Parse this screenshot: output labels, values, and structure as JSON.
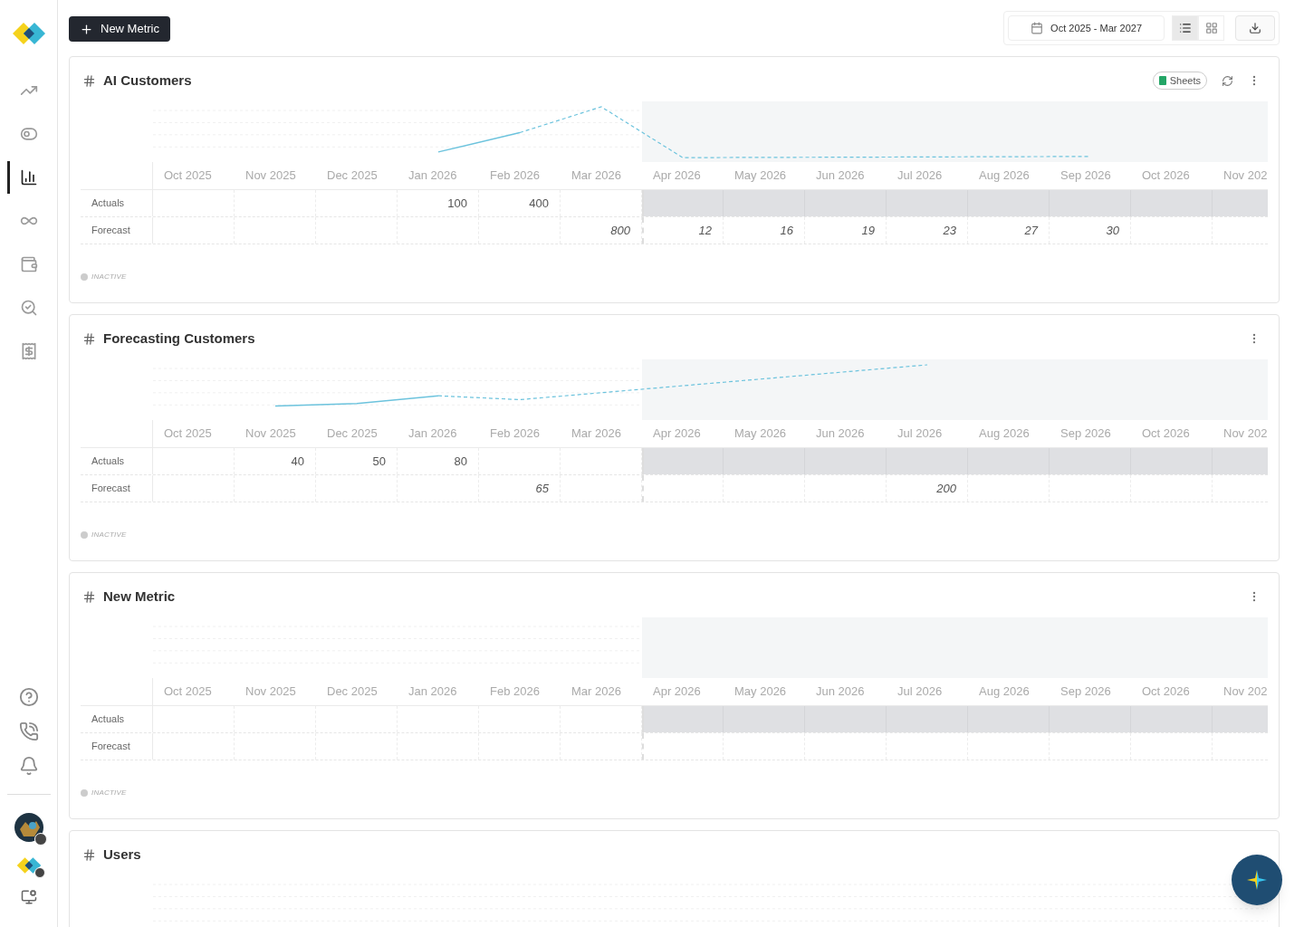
{
  "sidebar": {
    "items": [
      {
        "kind": "trend",
        "selected": false
      },
      {
        "kind": "toggles",
        "selected": false
      },
      {
        "kind": "bars",
        "selected": true
      },
      {
        "kind": "loop",
        "selected": false
      },
      {
        "kind": "wallet",
        "selected": false
      },
      {
        "kind": "explore",
        "selected": false
      },
      {
        "kind": "invoice",
        "selected": false
      }
    ],
    "bottom": [
      {
        "kind": "help"
      },
      {
        "kind": "phone"
      },
      {
        "kind": "bell"
      }
    ]
  },
  "toolbar": {
    "new_button": "New Metric",
    "date_range": "Oct 2025 - Mar 2027",
    "views": [
      {
        "kind": "list",
        "selected": true
      },
      {
        "kind": "grid",
        "selected": false
      }
    ]
  },
  "metrics": [
    {
      "title": "AI Customers",
      "source": "Sheets",
      "rows": [
        {
          "kind": "actual",
          "label": "Actuals"
        },
        {
          "kind": "forecast",
          "label": "Forecast"
        }
      ],
      "columns": [
        {
          "month": "Oct 2025",
          "projected": false
        },
        {
          "month": "Nov 2025",
          "projected": false
        },
        {
          "month": "Dec 2025",
          "projected": false
        },
        {
          "month": "Jan 2026",
          "projected": false,
          "actual": "100"
        },
        {
          "month": "Feb 2026",
          "projected": false,
          "actual": "400"
        },
        {
          "month": "Mar 2026",
          "projected": false,
          "forecast": "800"
        },
        {
          "month": "Apr 2026",
          "projected": true,
          "forecast": "12"
        },
        {
          "month": "May 2026",
          "projected": true,
          "forecast": "16"
        },
        {
          "month": "Jun 2026",
          "projected": true,
          "forecast": "19"
        },
        {
          "month": "Jul 2026",
          "projected": true,
          "forecast": "23"
        },
        {
          "month": "Aug 2026",
          "projected": true,
          "forecast": "27"
        },
        {
          "month": "Sep 2026",
          "projected": true,
          "forecast": "30"
        },
        {
          "month": "Oct 2026",
          "projected": true
        },
        {
          "month": "Nov 202",
          "projected": true
        }
      ],
      "status": {
        "label": "INACTIVE",
        "active": false
      }
    },
    {
      "title": "Forecasting Customers",
      "rows": [
        {
          "kind": "actual",
          "label": "Actuals"
        },
        {
          "kind": "forecast",
          "label": "Forecast"
        }
      ],
      "columns": [
        {
          "month": "Oct 2025",
          "projected": false
        },
        {
          "month": "Nov 2025",
          "projected": false,
          "actual": "40"
        },
        {
          "month": "Dec 2025",
          "projected": false,
          "actual": "50"
        },
        {
          "month": "Jan 2026",
          "projected": false,
          "actual": "80"
        },
        {
          "month": "Feb 2026",
          "projected": false,
          "forecast": "65"
        },
        {
          "month": "Mar 2026",
          "projected": false
        },
        {
          "month": "Apr 2026",
          "projected": true
        },
        {
          "month": "May 2026",
          "projected": true
        },
        {
          "month": "Jun 2026",
          "projected": true
        },
        {
          "month": "Jul 2026",
          "projected": true,
          "forecast": "200"
        },
        {
          "month": "Aug 2026",
          "projected": true
        },
        {
          "month": "Sep 2026",
          "projected": true
        },
        {
          "month": "Oct 2026",
          "projected": true
        },
        {
          "month": "Nov 202",
          "projected": true
        }
      ],
      "status": {
        "label": "INACTIVE",
        "active": false
      }
    },
    {
      "title": "New Metric",
      "rows": [
        {
          "kind": "actual",
          "label": "Actuals"
        },
        {
          "kind": "forecast",
          "label": "Forecast"
        }
      ],
      "columns": [
        {
          "month": "Oct 2025",
          "projected": false
        },
        {
          "month": "Nov 2025",
          "projected": false
        },
        {
          "month": "Dec 2025",
          "projected": false
        },
        {
          "month": "Jan 2026",
          "projected": false
        },
        {
          "month": "Feb 2026",
          "projected": false
        },
        {
          "month": "Mar 2026",
          "projected": false
        },
        {
          "month": "Apr 2026",
          "projected": true
        },
        {
          "month": "May 2026",
          "projected": true
        },
        {
          "month": "Jun 2026",
          "projected": true
        },
        {
          "month": "Jul 2026",
          "projected": true
        },
        {
          "month": "Aug 2026",
          "projected": true
        },
        {
          "month": "Sep 2026",
          "projected": true
        },
        {
          "month": "Oct 2026",
          "projected": true
        },
        {
          "month": "Nov 202",
          "projected": true
        }
      ],
      "status": {
        "label": "INACTIVE",
        "active": false
      }
    },
    {
      "title": "Users"
    }
  ]
}
